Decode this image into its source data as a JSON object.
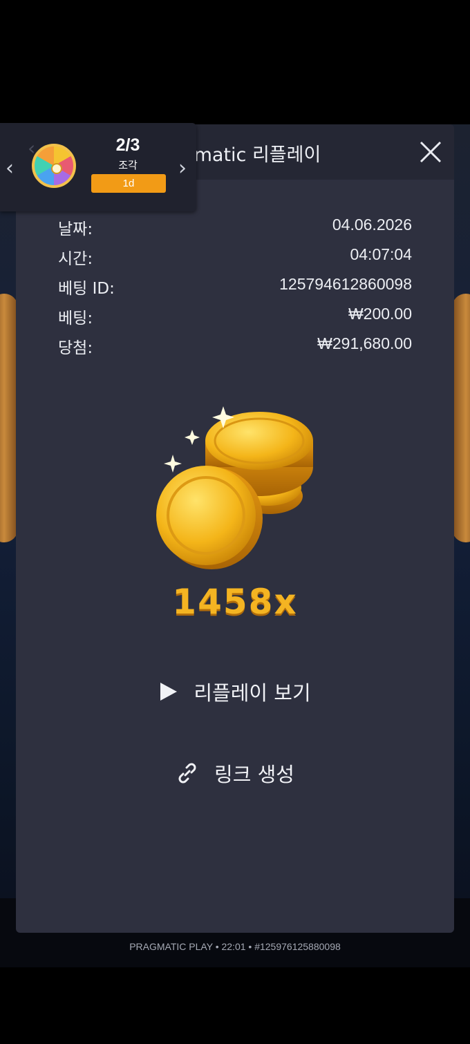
{
  "widget": {
    "count": "2/3",
    "label": "조각",
    "badge": "1d",
    "prev_arrow": "‹",
    "next_arrow": "›",
    "icon": "prize-wheel-icon"
  },
  "modal": {
    "title": "Pragmatic 리플레이",
    "close_icon": "close-icon"
  },
  "details": [
    {
      "label": "날짜:",
      "value": "04.06.2026"
    },
    {
      "label": "시간:",
      "value": "04:07:04"
    },
    {
      "label": "베팅 ID:",
      "value": "125794612860098"
    },
    {
      "label": "베팅:",
      "value": "₩200.00"
    },
    {
      "label": "당첨:",
      "value": "₩291,680.00"
    }
  ],
  "win": {
    "multiplier": "1458x",
    "icon": "gold-coins-icon"
  },
  "actions": {
    "replay_label": "리플레이 보기",
    "replay_icon": "play-icon",
    "link_label": "링크 생성",
    "link_icon": "link-icon"
  },
  "footer": {
    "meta": "PRAGMATIC PLAY • 22:01 • #125976125880098"
  },
  "colors": {
    "modal_bg": "#2e303f",
    "header_bg": "#252734",
    "badge": "#f29b16",
    "multiplier": "#f4b422"
  }
}
